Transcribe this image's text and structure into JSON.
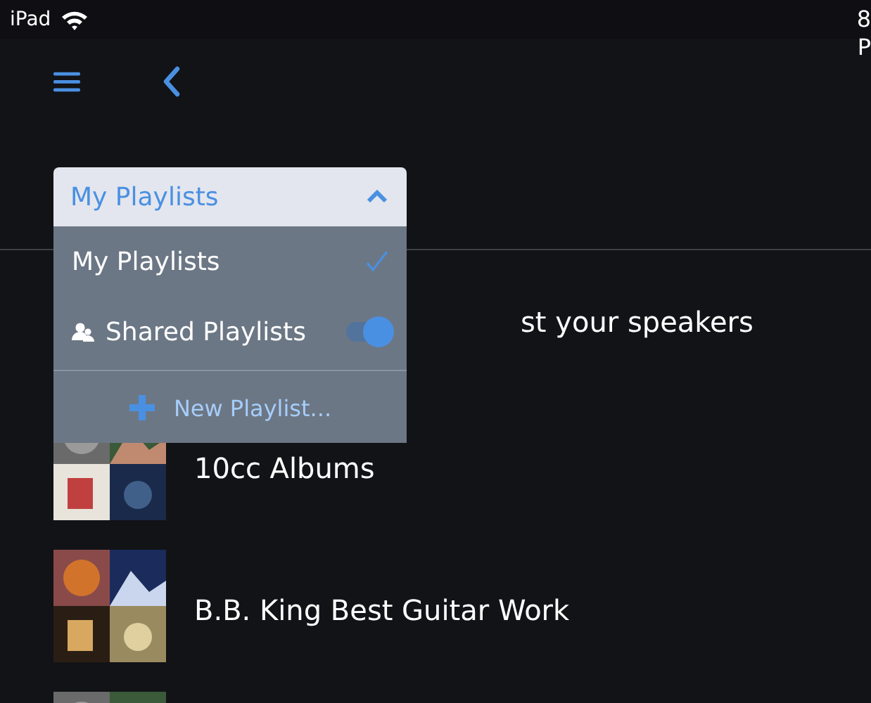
{
  "status_bar": {
    "device": "iPad",
    "clock_1": "8",
    "clock_2": "P"
  },
  "dropdown": {
    "title": "My Playlists",
    "expanded": true,
    "options": [
      {
        "kind": "check",
        "label": "My Playlists",
        "selected": true
      },
      {
        "kind": "toggle",
        "label": "Shared Playlists",
        "on": true
      }
    ],
    "action": "New Playlist..."
  },
  "playlists": [
    {
      "title": "st your speakers",
      "covered": true
    },
    {
      "title": "10cc Albums",
      "covered": false
    },
    {
      "title": "B.B. King Best Guitar Work",
      "covered": false
    },
    {
      "covered": false
    }
  ]
}
